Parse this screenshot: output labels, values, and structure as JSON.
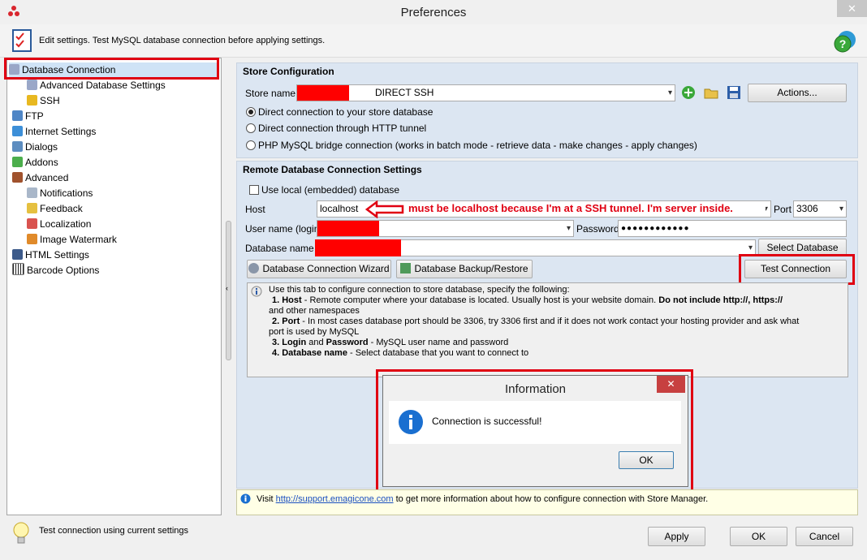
{
  "window": {
    "title": "Preferences",
    "close_glyph": "✕"
  },
  "header": {
    "text": "Edit settings. Test MySQL database connection before applying settings."
  },
  "tree": {
    "items": [
      {
        "label": "Database Connection"
      },
      {
        "label": "Advanced Database Settings"
      },
      {
        "label": "SSH"
      },
      {
        "label": "FTP"
      },
      {
        "label": "Internet Settings"
      },
      {
        "label": "Dialogs"
      },
      {
        "label": "Addons"
      },
      {
        "label": "Advanced"
      },
      {
        "label": "Notifications"
      },
      {
        "label": "Feedback"
      },
      {
        "label": "Localization"
      },
      {
        "label": "Image Watermark"
      },
      {
        "label": "HTML Settings"
      },
      {
        "label": "Barcode Options"
      }
    ]
  },
  "store": {
    "section_title": "Store Configuration",
    "store_name_label": "Store name",
    "store_name_value": "DIRECT SSH",
    "actions_label": "Actions...",
    "radios": [
      {
        "label": "Direct connection to your store database",
        "checked": true
      },
      {
        "label": "Direct connection through HTTP tunnel",
        "checked": false
      },
      {
        "label": "PHP MySQL bridge connection (works in batch mode - retrieve data - make changes - apply changes)",
        "checked": false
      }
    ]
  },
  "remote": {
    "section_title": "Remote Database Connection Settings",
    "use_local_label": "Use local (embedded) database",
    "host_label": "Host",
    "host_value": "localhost",
    "annotation": "must be localhost because I'm at a SSH tunnel. I'm server inside.",
    "port_label": "Port",
    "port_value": "3306",
    "user_label": "User name (login)",
    "password_label": "Password",
    "password_value": "●●●●●●●●●●●●",
    "dbname_label": "Database name",
    "select_db_label": "Select Database",
    "wizard_label": "Database Connection Wizard",
    "backup_label": "Database Backup/Restore",
    "test_label": "Test Connection"
  },
  "help": {
    "intro": "Use this tab to configure connection to store database, specify the following:",
    "line1a": "1. Host",
    "line1b": " - Remote computer where your database is located. Usually host is your website domain. ",
    "line1c": "Do not include http://, https://",
    "line1d": "and other namespaces",
    "line2a": "2. Port",
    "line2b": " - In most cases database port should be 3306, try 3306 first and if it does not work contact your hosting provider and ask what",
    "line2c": "port is used by MySQL",
    "line3a": "3. Login",
    "line3b": " and ",
    "line3c": "Password",
    "line3d": " - MySQL user name and password",
    "line4a": "4. Database name",
    "line4b": " - Select database that you want to connect to"
  },
  "dialog": {
    "title": "Information",
    "message": "Connection is successful!",
    "ok_label": "OK",
    "close_glyph": "✕"
  },
  "footer_note": {
    "visit": "Visit ",
    "link": "http://support.emagicone.com",
    "rest": " to get more information about how to configure connection with Store Manager."
  },
  "status": {
    "text": "Test connection using current settings"
  },
  "buttons": {
    "apply": "Apply",
    "ok": "OK",
    "cancel": "Cancel"
  },
  "colors": {
    "highlight_red": "#e00012",
    "annotation_red": "#e00012",
    "group_bg": "#dce6f2",
    "selection": "#cfe3f6"
  }
}
